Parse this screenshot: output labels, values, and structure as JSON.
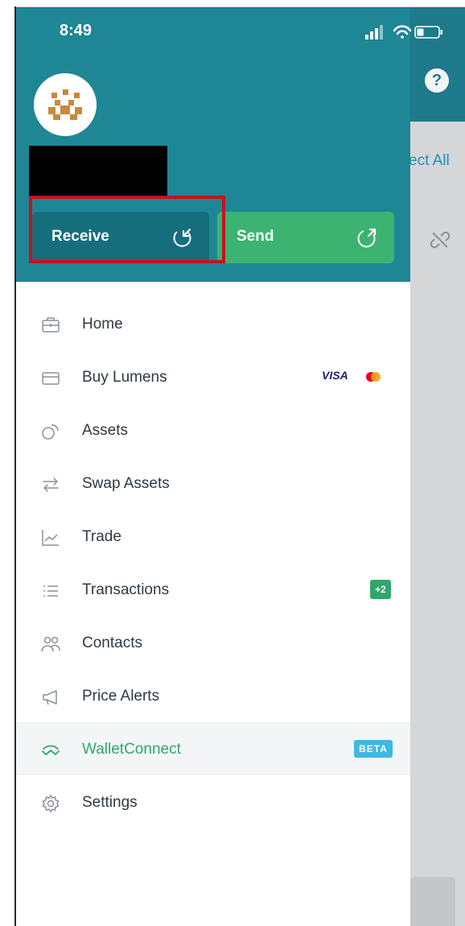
{
  "status_bar": {
    "time": "8:49"
  },
  "background": {
    "select_all_text": "ect All",
    "help_label": "?"
  },
  "wallet": {
    "receive_label": "Receive",
    "send_label": "Send",
    "receive_color": "#166e7c",
    "send_color": "#3cb371",
    "header_color": "#1f8696"
  },
  "menu": {
    "items": [
      {
        "label": "Home",
        "icon": "briefcase-icon"
      },
      {
        "label": "Buy Lumens",
        "icon": "card-icon",
        "visa": "VISA"
      },
      {
        "label": "Assets",
        "icon": "coins-icon"
      },
      {
        "label": "Swap Assets",
        "icon": "swap-icon"
      },
      {
        "label": "Trade",
        "icon": "chart-icon"
      },
      {
        "label": "Transactions",
        "icon": "list-icon",
        "badge": "+2"
      },
      {
        "label": "Contacts",
        "icon": "contacts-icon"
      },
      {
        "label": "Price Alerts",
        "icon": "megaphone-icon"
      },
      {
        "label": "WalletConnect",
        "icon": "walletconnect-icon",
        "badge": "BETA",
        "active": true
      },
      {
        "label": "Settings",
        "icon": "gear-icon"
      }
    ]
  }
}
